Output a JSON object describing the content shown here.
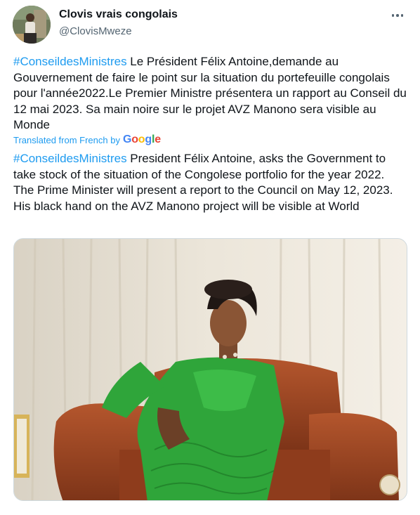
{
  "author": {
    "display_name": "Clovis vrais congolais",
    "handle": "@ClovisMweze"
  },
  "tweet": {
    "original_hashtag": "#ConseildesMinistres",
    "original_text": " Le Président Félix Antoine,demande au Gouvernement de faire le point sur la situation du portefeuille congolais pour l'année2022.Le Premier Ministre présentera un rapport au Conseil du 12 mai 2023. Sa main noire sur le projet AVZ Manono sera visible au Monde",
    "translation_note": "Translated from French by",
    "translation_brand": {
      "g1": "G",
      "o1": "o",
      "o2": "o",
      "g2": "g",
      "l": "l",
      "e": "e"
    },
    "translated_hashtag": "#ConseildesMinistres",
    "translated_text": " President Félix Antoine, asks the Government to take stock of the situation of the Congolese portfolio for the year 2022. The Prime Minister will present a report to the Council on May 12, 2023. His black hand on the AVZ Manono project will be visible at World"
  },
  "colors": {
    "link": "#1d9bf0",
    "text": "#0f1419",
    "secondary": "#536471",
    "dress": "#2fa53a"
  },
  "icons": {
    "more": "more-dots-icon"
  }
}
